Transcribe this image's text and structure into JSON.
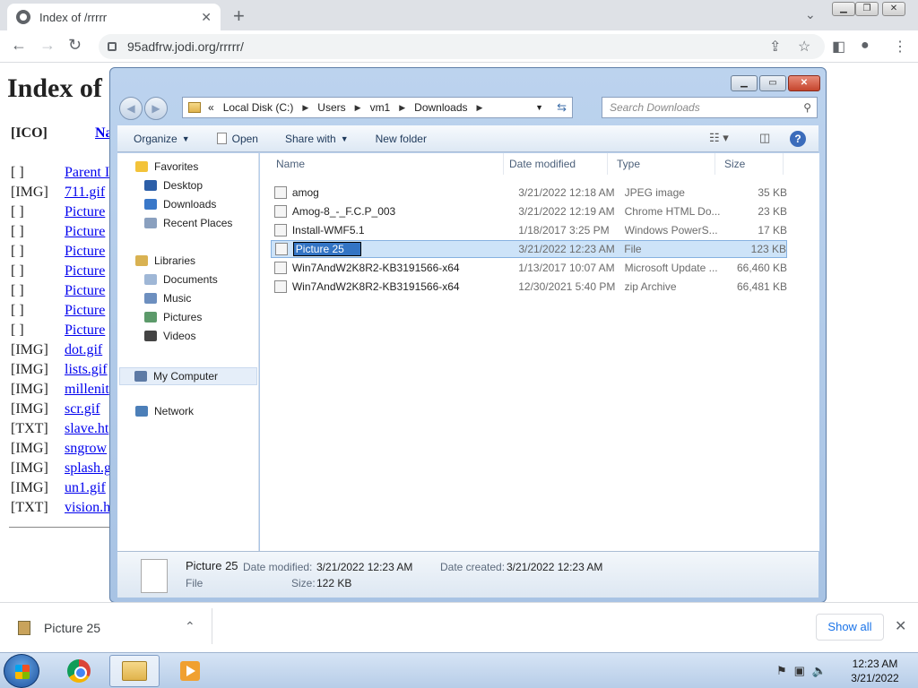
{
  "browser": {
    "tab_title": "Index of /rrrrr",
    "url": "95adfrw.jodi.org/rrrrr/"
  },
  "page": {
    "heading": "Index of",
    "hdr_ico": "[ICO]",
    "hdr_name": "Na",
    "rows": [
      {
        "alt": "[ ]",
        "link": "Parent I"
      },
      {
        "alt": "[IMG]",
        "link": "711.gif"
      },
      {
        "alt": "[ ]",
        "link": "Picture"
      },
      {
        "alt": "[ ]",
        "link": "Picture"
      },
      {
        "alt": "[ ]",
        "link": "Picture"
      },
      {
        "alt": "[ ]",
        "link": "Picture"
      },
      {
        "alt": "[ ]",
        "link": "Picture"
      },
      {
        "alt": "[ ]",
        "link": "Picture"
      },
      {
        "alt": "[ ]",
        "link": "Picture"
      },
      {
        "alt": "[IMG]",
        "link": "dot.gif"
      },
      {
        "alt": "[IMG]",
        "link": "lists.gif"
      },
      {
        "alt": "[IMG]",
        "link": "millenit"
      },
      {
        "alt": "[IMG]",
        "link": "scr.gif"
      },
      {
        "alt": "[TXT]",
        "link": "slave.ht"
      },
      {
        "alt": "[IMG]",
        "link": "sngrow"
      },
      {
        "alt": "[IMG]",
        "link": "splash.g"
      },
      {
        "alt": "[IMG]",
        "link": "un1.gif"
      },
      {
        "alt": "[TXT]",
        "link": "vision.h"
      }
    ]
  },
  "explorer": {
    "breadcrumb": [
      "«",
      "Local Disk (C:)",
      "Users",
      "vm1",
      "Downloads"
    ],
    "search_placeholder": "Search Downloads",
    "commands": {
      "organize": "Organize",
      "open": "Open",
      "share_with": "Share with",
      "new_folder": "New folder"
    },
    "nav": {
      "favorites": "Favorites",
      "desktop": "Desktop",
      "downloads": "Downloads",
      "recent_places": "Recent Places",
      "libraries": "Libraries",
      "documents": "Documents",
      "music": "Music",
      "pictures": "Pictures",
      "videos": "Videos",
      "my_computer": "My Computer",
      "network": "Network"
    },
    "columns": {
      "name": "Name",
      "date": "Date modified",
      "type": "Type",
      "size": "Size"
    },
    "files": [
      {
        "name": "amog",
        "date": "3/21/2022 12:18 AM",
        "type": "JPEG image",
        "size": "35 KB",
        "icon": "jpeg-icon"
      },
      {
        "name": "Amog-8_-_F.C.P_003",
        "date": "3/21/2022 12:19 AM",
        "type": "Chrome HTML Do...",
        "size": "23 KB",
        "icon": "chrome-html-icon"
      },
      {
        "name": "Install-WMF5.1",
        "date": "1/18/2017 3:25 PM",
        "type": "Windows PowerS...",
        "size": "17 KB",
        "icon": "powershell-icon"
      },
      {
        "name": "Picture 25",
        "date": "3/21/2022 12:23 AM",
        "type": "File",
        "size": "123 KB",
        "icon": "file-icon"
      },
      {
        "name": "Win7AndW2K8R2-KB3191566-x64",
        "date": "1/13/2017 10:07 AM",
        "type": "Microsoft Update ...",
        "size": "66,460 KB",
        "icon": "msu-icon"
      },
      {
        "name": "Win7AndW2K8R2-KB3191566-x64",
        "date": "12/30/2021 5:40 PM",
        "type": "zip Archive",
        "size": "66,481 KB",
        "icon": "zip-icon"
      }
    ],
    "details": {
      "name": "Picture 25",
      "type": "File",
      "date_modified_label": "Date modified:",
      "date_modified": "3/21/2022 12:23 AM",
      "date_created_label": "Date created:",
      "date_created": "3/21/2022 12:23 AM",
      "size_label": "Size:",
      "size": "122 KB"
    }
  },
  "downloads_shelf": {
    "item": "Picture 25",
    "show_all": "Show all"
  },
  "taskbar": {
    "time": "12:23 AM",
    "date": "3/21/2022"
  }
}
